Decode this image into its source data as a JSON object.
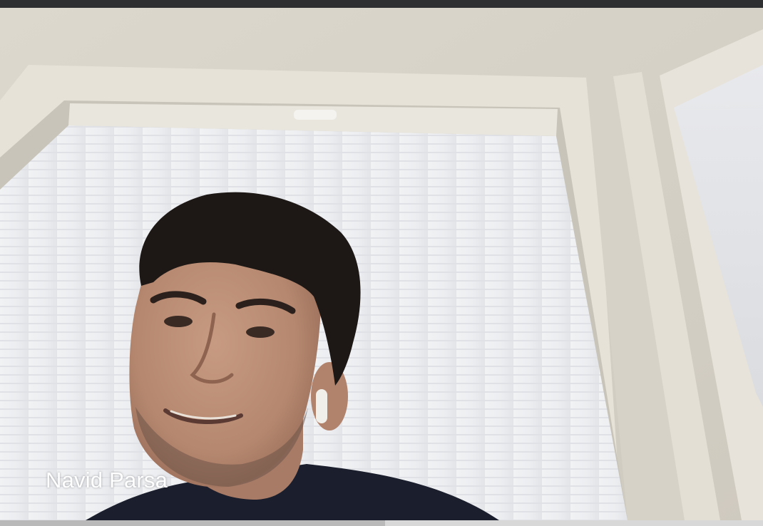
{
  "participant": {
    "name": "Navid Parsa"
  },
  "colors": {
    "wall": "#d9d5cb",
    "blind": "#eef0f3",
    "frame": "#e4e0d6",
    "shirt": "#1b1e2c",
    "hair": "#1d1816",
    "skin": "#b98a72",
    "name_text": "#ffffff"
  }
}
